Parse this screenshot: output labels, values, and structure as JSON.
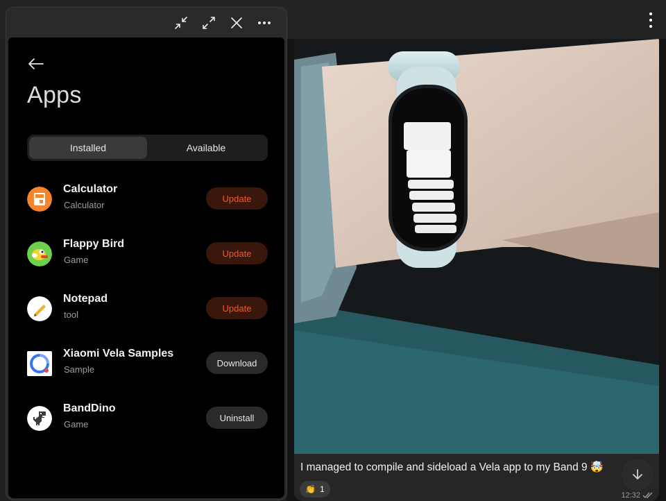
{
  "app": {
    "title": "Apps",
    "tabs": [
      {
        "label": "Installed",
        "active": true
      },
      {
        "label": "Available",
        "active": false
      }
    ],
    "items": [
      {
        "name": "Calculator",
        "category": "Calculator",
        "action": "Update",
        "icon": "calculator-icon"
      },
      {
        "name": "Flappy Bird",
        "category": "Game",
        "action": "Update",
        "icon": "flappy-bird-icon"
      },
      {
        "name": "Notepad",
        "category": "tool",
        "action": "Update",
        "icon": "notepad-icon"
      },
      {
        "name": "Xiaomi Vela Samples",
        "category": "Sample",
        "action": "Download",
        "icon": "vela-samples-icon"
      },
      {
        "name": "BandDino",
        "category": "Game",
        "action": "Uninstall",
        "icon": "dino-icon"
      }
    ]
  },
  "window_controls": [
    "minimize-icon",
    "maximize-icon",
    "close-icon",
    "more-icon"
  ],
  "chat": {
    "caption": "I managed to compile and sideload a Vela app to my Band 9 🤯",
    "reaction_emoji": "👏",
    "reaction_count": "1",
    "time": "12:32"
  },
  "colors": {
    "accent": "#f05a2c",
    "update_bg": "#3a170d",
    "window_bg": "#2a2a2c",
    "app_bg": "#000000"
  }
}
